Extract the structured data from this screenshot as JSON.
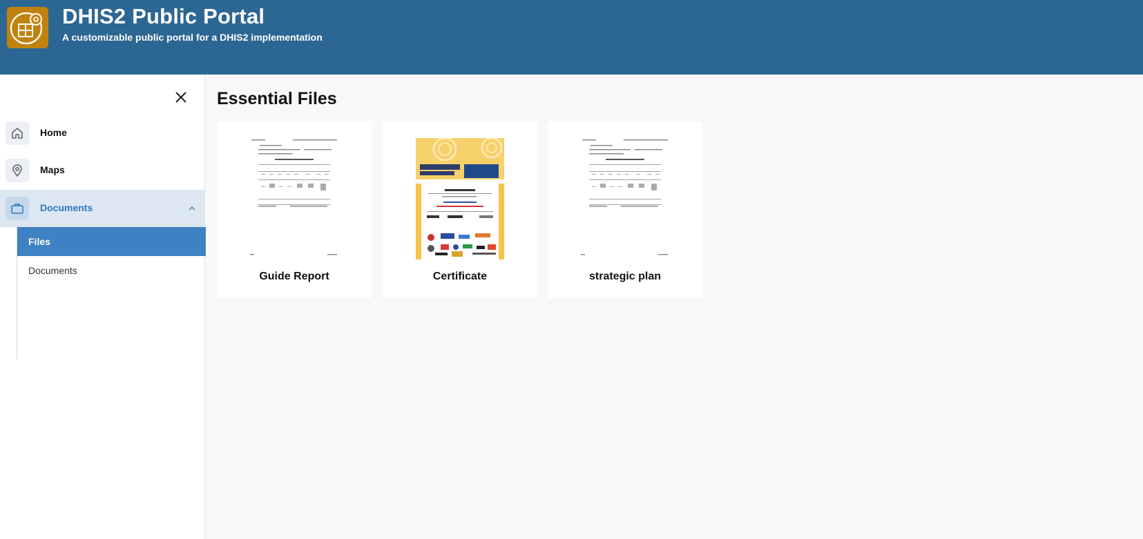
{
  "header": {
    "title": "DHIS2 Public Portal",
    "subtitle": "A customizable public portal for a DHIS2 implementation",
    "logo_icon": "dhis2-settings-logo-icon",
    "bg_color": "#2c6693",
    "logo_color": "#c1830f"
  },
  "sidebar": {
    "close_icon": "close-icon",
    "items": [
      {
        "label": "Home",
        "icon": "home-icon"
      },
      {
        "label": "Maps",
        "icon": "map-pin-icon"
      },
      {
        "label": "Documents",
        "icon": "briefcase-icon",
        "expanded": true
      }
    ],
    "subitems": [
      {
        "label": "Files",
        "active": true
      },
      {
        "label": "Documents",
        "active": false
      }
    ],
    "active_color": "#3f82c3"
  },
  "main": {
    "title": "Essential Files",
    "cards": [
      {
        "label": "Guide Report",
        "thumbnail": "document-thumbnail"
      },
      {
        "label": "Certificate",
        "thumbnail": "certificate-thumbnail"
      },
      {
        "label": "strategic plan",
        "thumbnail": "document-thumbnail"
      }
    ]
  }
}
